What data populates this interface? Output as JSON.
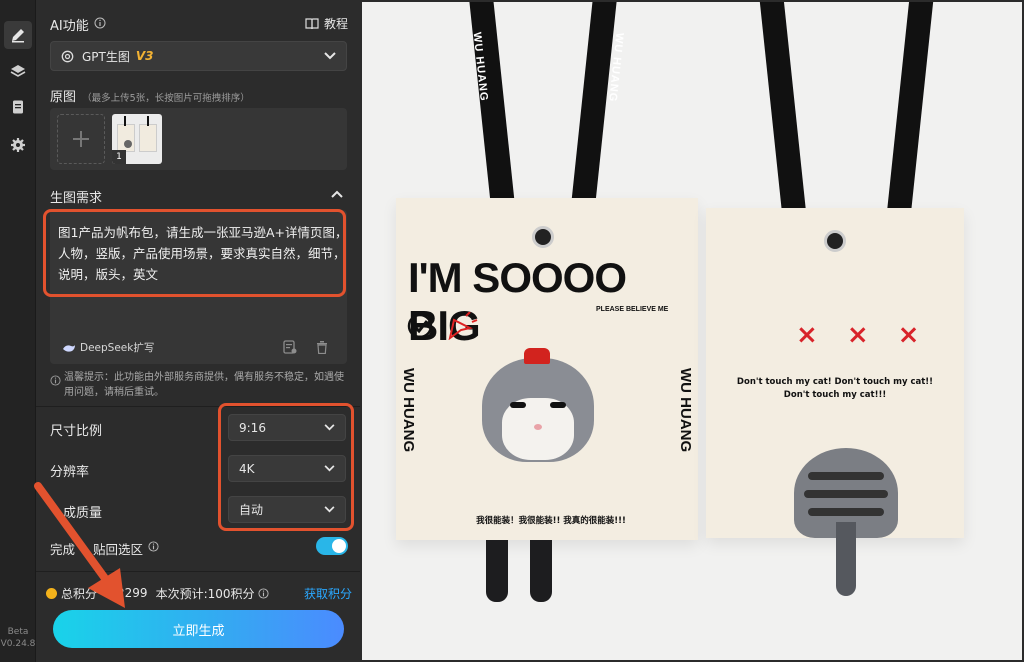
{
  "ai_function": {
    "title": "AI功能",
    "tutorial": "教程",
    "model_name": "GPT生图",
    "model_version": "V3"
  },
  "original": {
    "title": "原图",
    "hint": "（最多上传5张，长按图片可拖拽排序）",
    "thumb_badge": "1"
  },
  "request": {
    "title": "生图需求",
    "text": "图1产品为帆布包，请生成一张亚马逊A+详情页图，人物，竖版，产品使用场景，要求真实自然，细节，说明，版头，英文",
    "deepseek_label": "DeepSeek扩写",
    "notice": "温馨提示：此功能由外部服务商提供，偶有服务不稳定，如遇使用问题，请稍后重试。"
  },
  "settings": {
    "ratio_label": "尺寸比例",
    "ratio_value": "9:16",
    "resolution_label": "分辨率",
    "resolution_value": "4K",
    "quality_label": "生成质量",
    "quality_label_visible": "成质量",
    "quality_value": "自动",
    "paste_label": "完成后粘贴回选区",
    "paste_label_visible_a": "完成",
    "paste_label_visible_b": "贴回选区",
    "paste_enabled": true
  },
  "points": {
    "total_label": "总积分",
    "total_visible": "总积分",
    "total_value": "2299",
    "estimate": "本次预计:100积分",
    "earn_link": "获取积分"
  },
  "generate_button": "立即生成",
  "app": {
    "beta": "Beta",
    "version": "V0.24.8"
  },
  "product": {
    "front_headline": "I'M SOOOO BIG",
    "front_subline": "PLEASE BELIEVE ME",
    "strap_text": "WU HUANG",
    "front_bottom": "我很能装！我很能装!! 我真的很能装!!!",
    "back_text_1": "Don't touch my cat!  Don't touch my cat!!",
    "back_text_2": "Don't touch my cat!!!",
    "back_marks": "× × ×"
  },
  "colors": {
    "accent_orange": "#e2522e",
    "brand_cyan": "#19d3e9",
    "link_blue": "#2aa8ff",
    "coin": "#f3b21b"
  }
}
